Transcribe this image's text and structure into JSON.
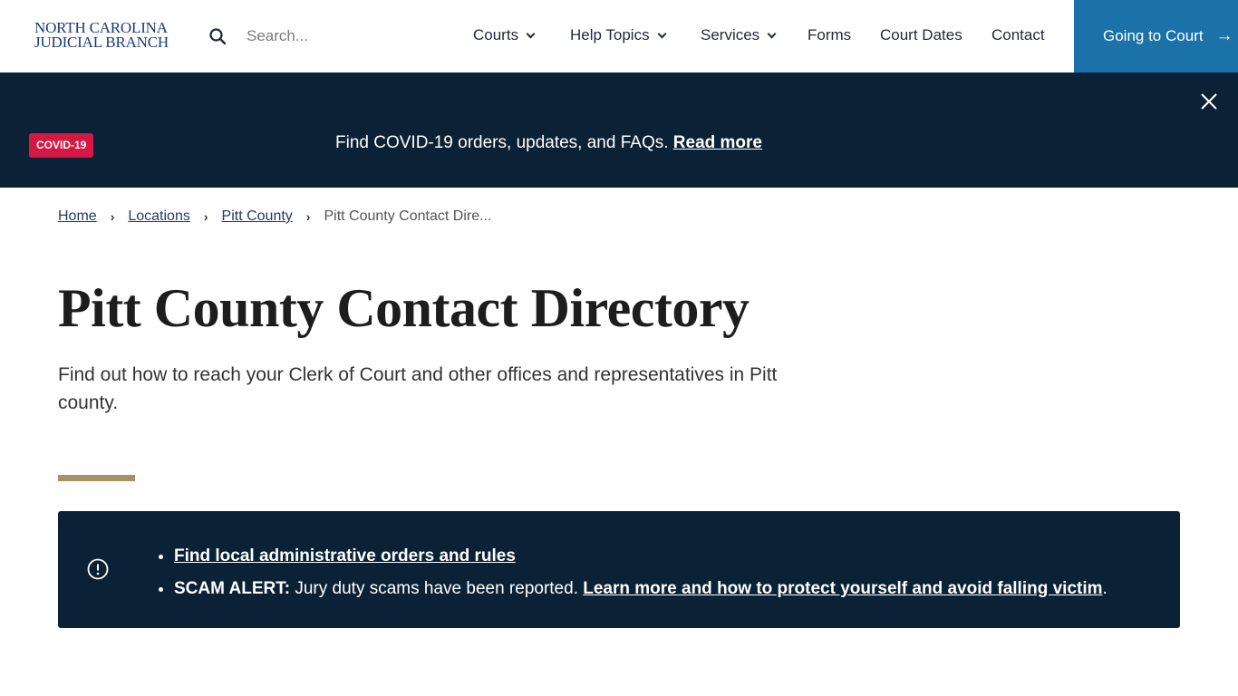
{
  "header": {
    "logo_line1": "NORTH CAROLINA",
    "logo_line2": "JUDICIAL BRANCH",
    "search_placeholder": "Search...",
    "nav": [
      {
        "label": "Courts",
        "has_dropdown": true
      },
      {
        "label": "Help Topics",
        "has_dropdown": true
      },
      {
        "label": "Services",
        "has_dropdown": true
      },
      {
        "label": "Forms",
        "has_dropdown": false
      },
      {
        "label": "Court Dates",
        "has_dropdown": false
      },
      {
        "label": "Contact",
        "has_dropdown": false
      }
    ],
    "cta_label": "Going to Court",
    "cta_icon": "arrow-right-icon"
  },
  "banner": {
    "badge": "COVID-19",
    "text": "Find COVID-19 orders, updates, and FAQs.",
    "link": "Read more",
    "close_icon": "close-icon"
  },
  "breadcrumb": {
    "items": [
      "Home",
      "Locations",
      "Pitt County"
    ],
    "current": "Pitt County Contact Dire..."
  },
  "page": {
    "title": "Pitt County Contact Directory",
    "intro": "Find out how to reach your Clerk of Court and other offices and representatives in Pitt county."
  },
  "alert": {
    "icon": "alert-circle-icon",
    "item1_link": "Find local administrative orders and rules",
    "item2_label": "SCAM ALERT:",
    "item2_text": " Jury duty scams have been reported. ",
    "item2_link": "Learn more and how to protect yourself and avoid falling victim",
    "item2_end": "."
  },
  "colors": {
    "banner_bg": "#0a2136",
    "cta_bg": "#1a72a8",
    "badge_bg": "#d31843",
    "accent": "#a88f68",
    "logo": "#1a3a7a"
  }
}
